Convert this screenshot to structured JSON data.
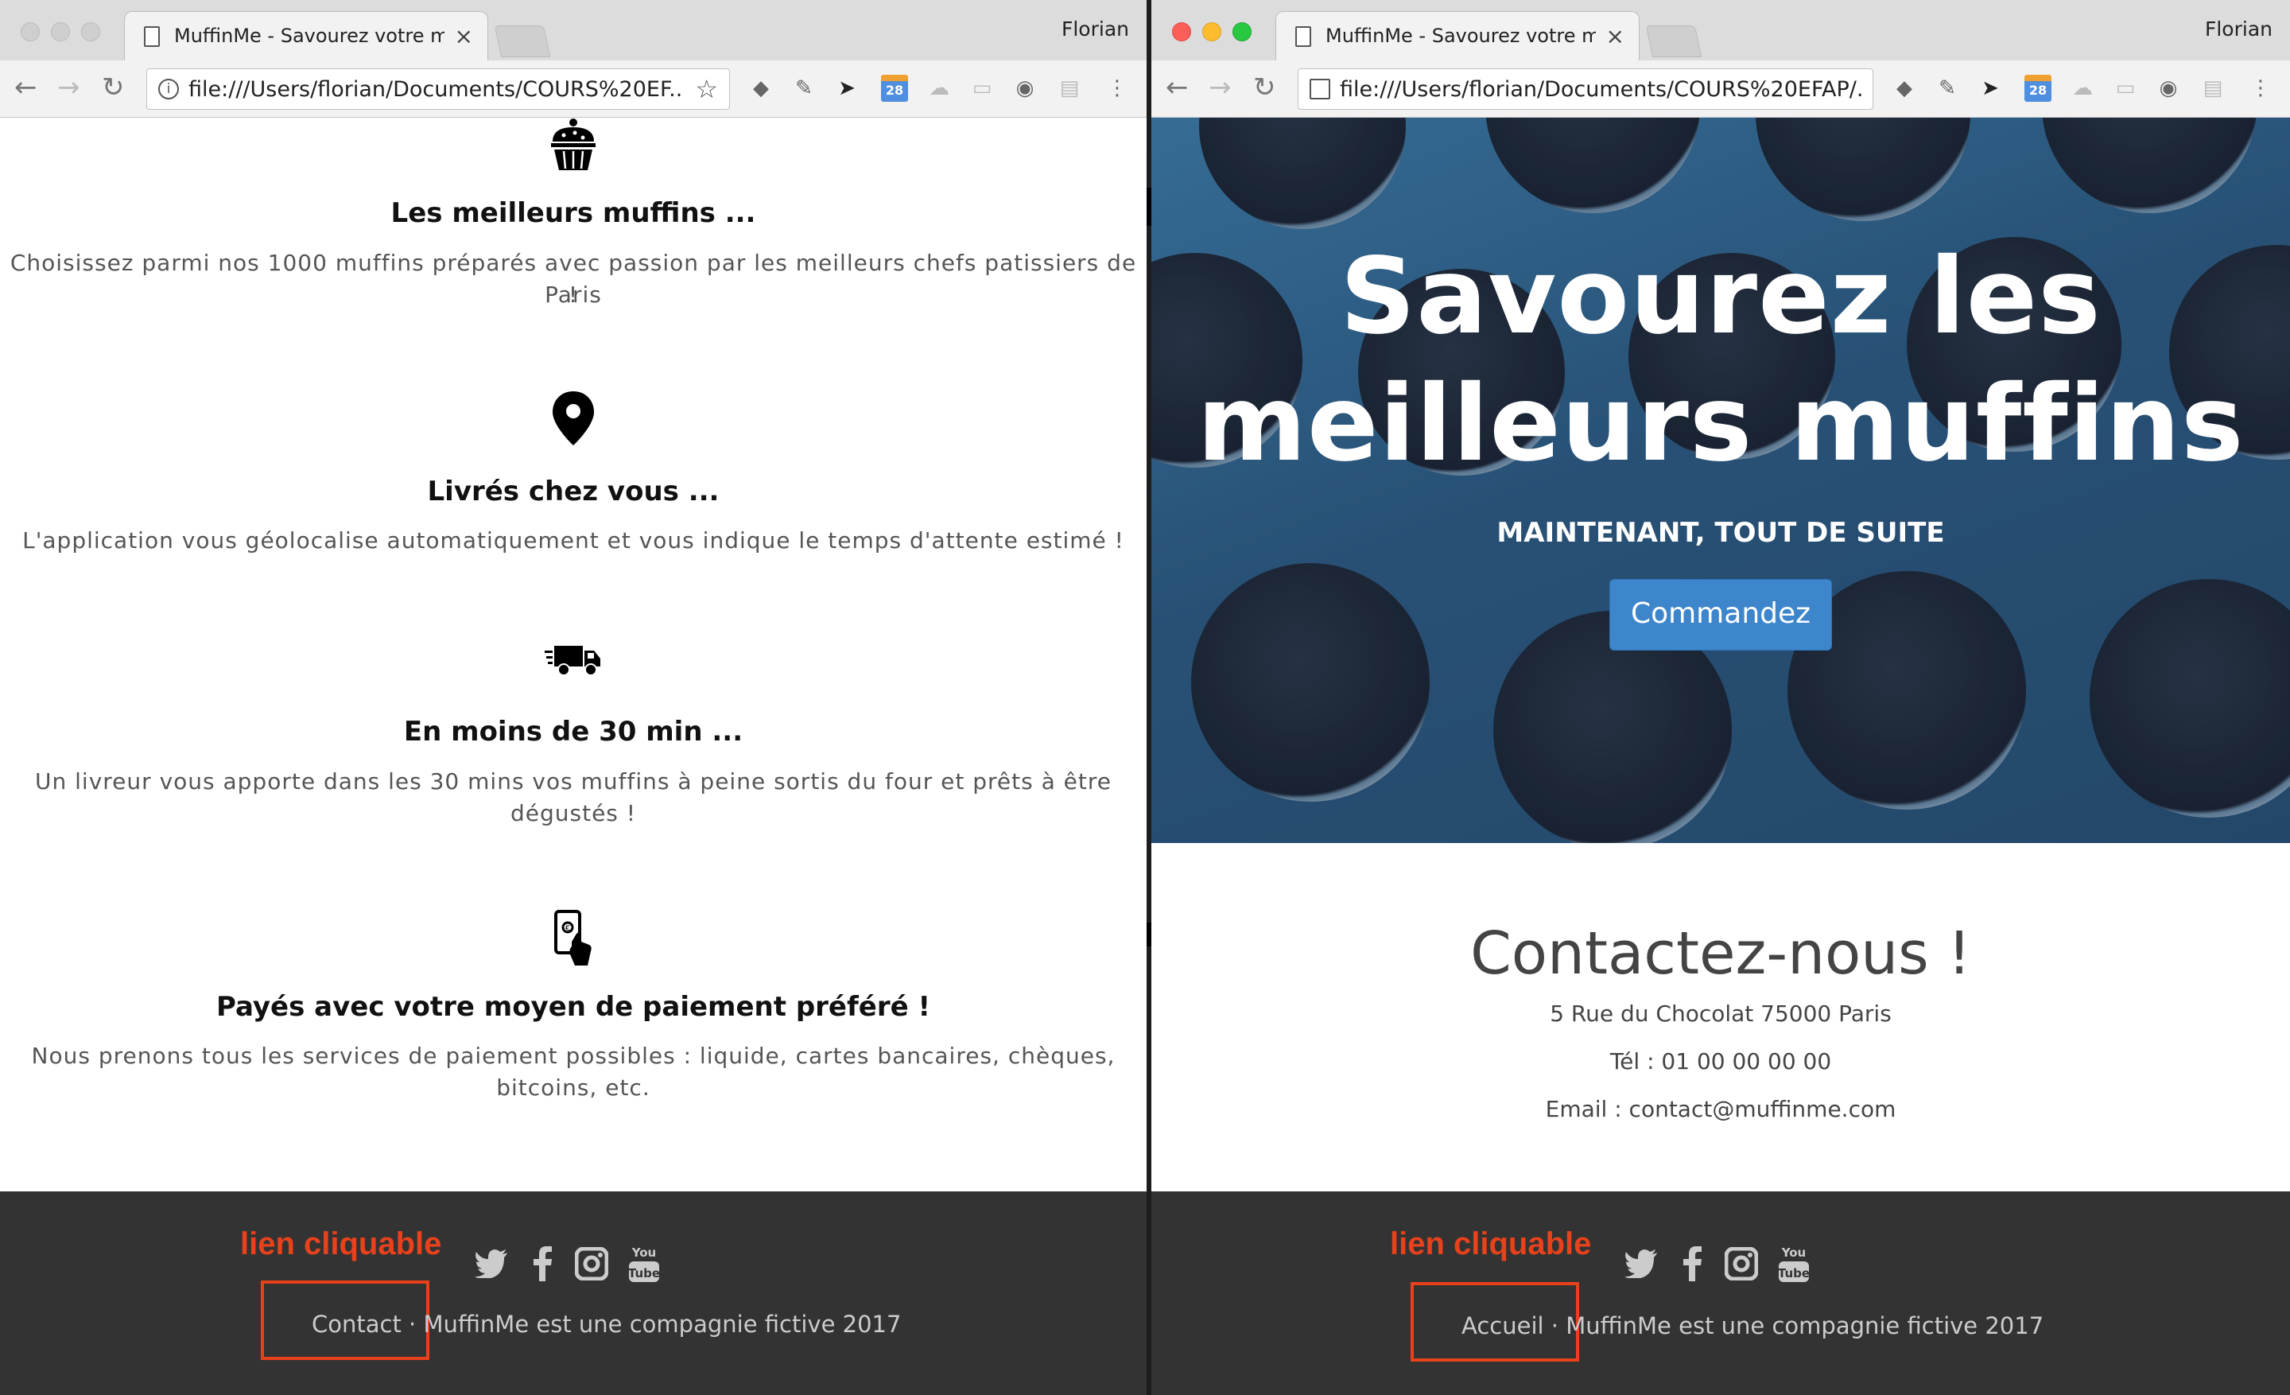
{
  "windows": [
    {
      "id": "left",
      "tab_title": "MuffinMe - Savourez votre mu",
      "tab_close": "×",
      "profile": "Florian",
      "url": "file:///Users/florian/Documents/COURS%20EF...",
      "features": [
        {
          "title": "Les meilleurs muffins ...",
          "text": "Choisissez parmi nos 1000 muffins préparés avec passion par les meilleurs chefs patissiers de Paris",
          "text2": "!",
          "icon": "cupcake-icon"
        },
        {
          "title": "Livrés chez vous ...",
          "text": "L'application vous géolocalise automatiquement et vous indique le temps d'attente estimé !",
          "text2": "",
          "icon": "map-pin-icon"
        },
        {
          "title": "En moins de 30 min ...",
          "text": "Un livreur vous apporte dans les 30 mins vos muffins à peine sortis du four et prêts à être",
          "text2": "dégustés !",
          "icon": "delivery-truck-icon"
        },
        {
          "title": "Payés avec votre moyen de paiement préféré !",
          "text": "Nous prenons tous les services de paiement possibles : liquide, cartes bancaires, chèques,",
          "text2": "bitcoins, etc.",
          "icon": "phone-payment-icon"
        }
      ],
      "footer": {
        "annotation": "lien cliquable",
        "link": "Contact",
        "copyright": "· MuffinMe est une compagnie fictive 2017"
      }
    },
    {
      "id": "right",
      "tab_title": "MuffinMe - Savourez votre mu",
      "tab_close": "×",
      "profile": "Florian",
      "url": "file:///Users/florian/Documents/COURS%20EFAP/...",
      "hero": {
        "title_line1": "Savourez les",
        "title_line2": "meilleurs muffins",
        "subtitle": "MAINTENANT, TOUT DE SUITE",
        "cta": "Commandez"
      },
      "contact": {
        "heading": "Contactez-nous !",
        "address": "5 Rue du Chocolat 75000 Paris",
        "phone": "Tél : 01 00 00 00 00",
        "email": "Email : contact@muffinme.com"
      },
      "footer": {
        "annotation": "lien cliquable",
        "link": "Accueil",
        "copyright": "· MuffinMe est une compagnie fictive 2017"
      }
    }
  ],
  "extension_calendar_day": "28",
  "colors": {
    "annotation_red": "#e8411b",
    "footer_bg": "#333333",
    "cta_blue": "#3d86cc",
    "mac_close": "#fc5f57",
    "mac_min": "#fdbc2e",
    "mac_max": "#28c840"
  }
}
